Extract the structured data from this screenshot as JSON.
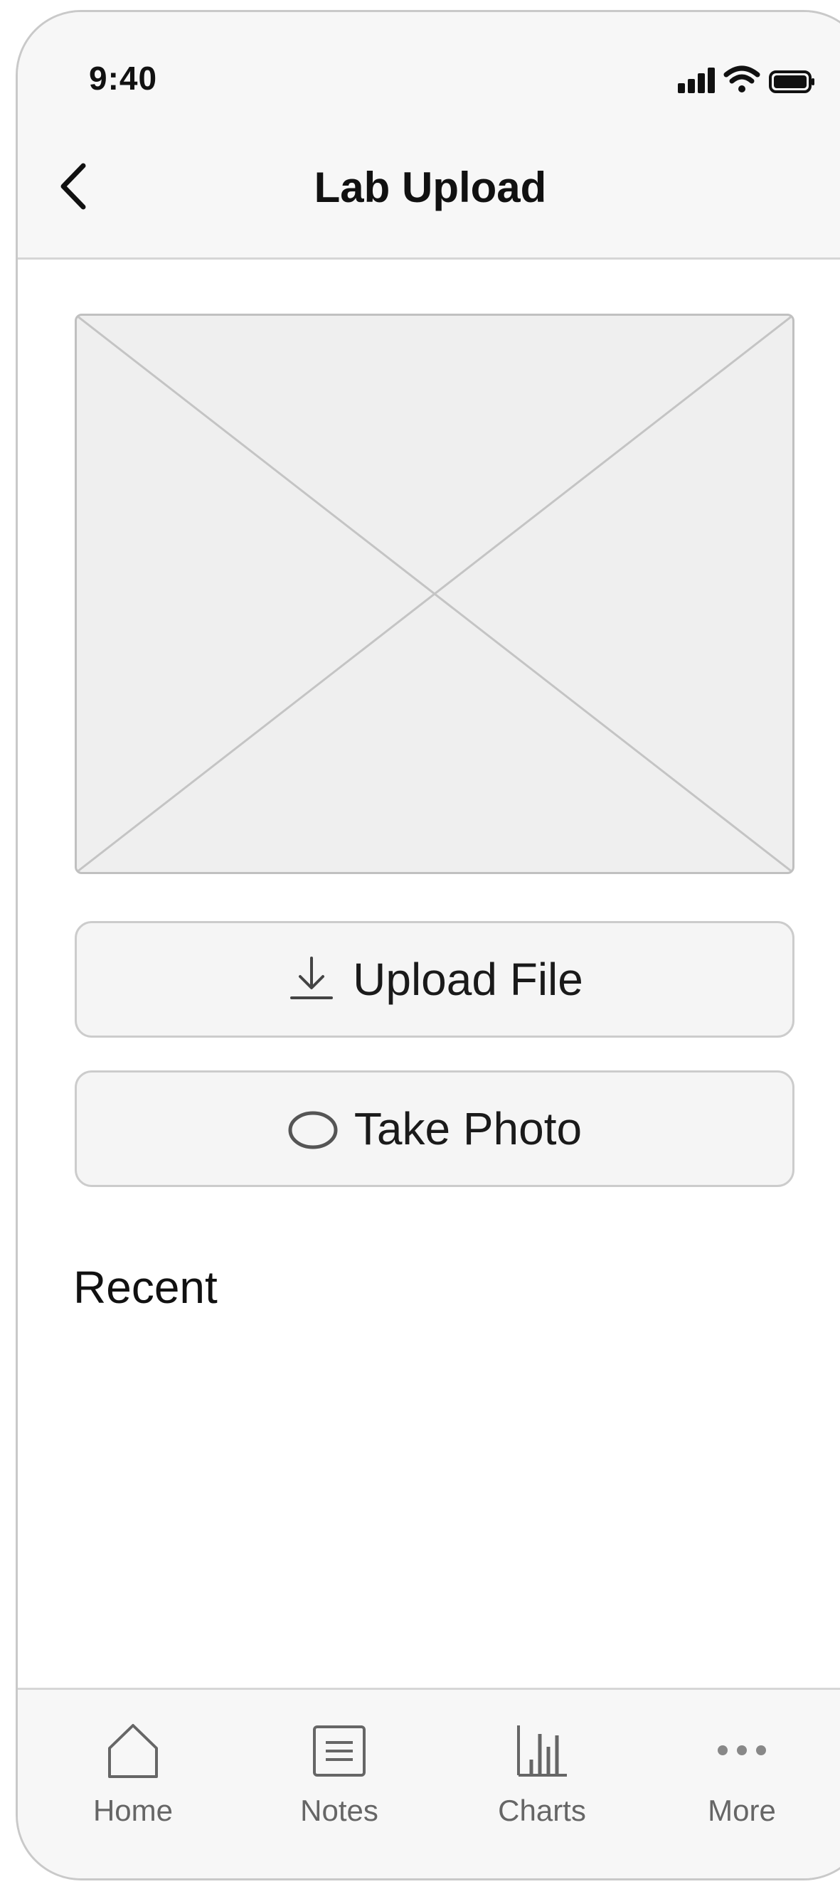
{
  "status_bar": {
    "time": "9:40"
  },
  "header": {
    "title": "Lab Upload",
    "back_icon": "chevron-left-icon"
  },
  "preview": {
    "icon": "image-placeholder"
  },
  "actions": {
    "upload": {
      "label": "Upload File",
      "icon": "download-arrow-icon"
    },
    "photo": {
      "label": "Take Photo",
      "icon": "camera-lens-icon"
    }
  },
  "recent": {
    "title": "Recent"
  },
  "tab_bar": {
    "items": [
      {
        "label": "Home",
        "icon": "home-icon"
      },
      {
        "label": "Notes",
        "icon": "notes-icon"
      },
      {
        "label": "Charts",
        "icon": "bar-chart-icon"
      },
      {
        "label": "More",
        "icon": "more-dots-icon"
      }
    ]
  },
  "colors": {
    "chrome_bg": "#f7f7f7",
    "border": "#d6d6d6",
    "text_primary": "#111111",
    "text_secondary": "#666666"
  }
}
